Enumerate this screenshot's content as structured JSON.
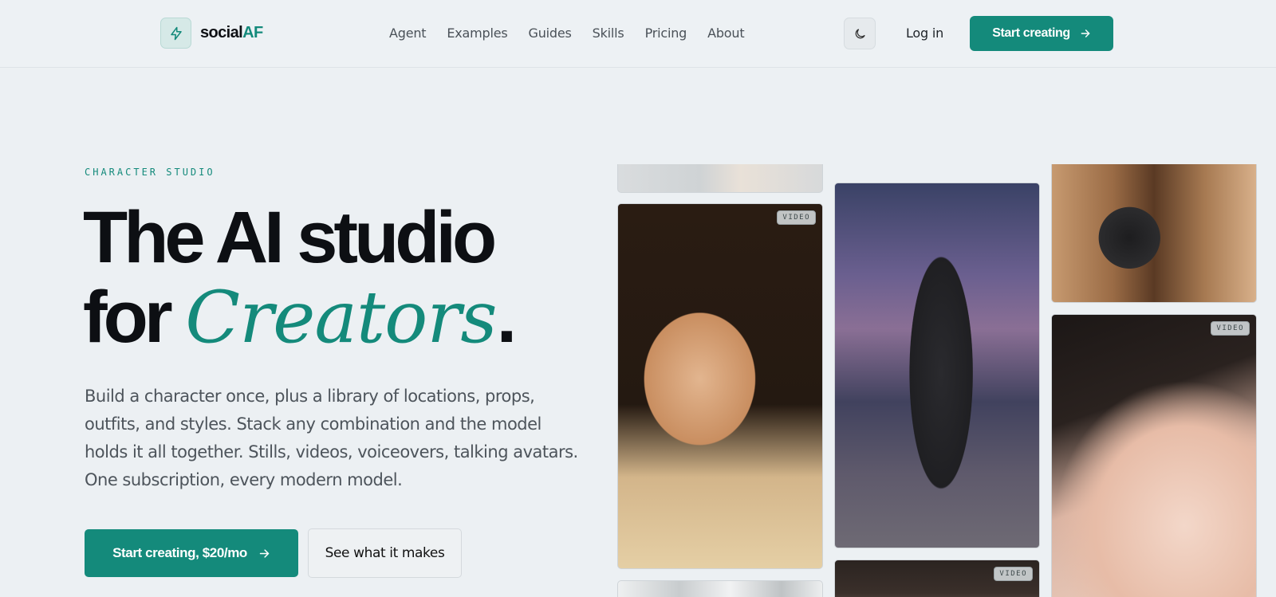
{
  "header": {
    "brand_main": "social",
    "brand_accent": "AF",
    "nav": [
      "Agent",
      "Examples",
      "Guides",
      "Skills",
      "Pricing",
      "About"
    ],
    "login": "Log in",
    "cta": "Start creating"
  },
  "hero": {
    "eyebrow": "CHARACTER STUDIO",
    "title_line1": "The AI studio",
    "title_line2_prefix": "for",
    "title_line2_script": "Creators",
    "title_line2_suffix": ".",
    "description": "Build a character once, plus a library of locations, props, outfits, and styles. Stack any combination and the model holds it all together. Stills, videos, voiceovers, talking avatars. One subscription, every modern model.",
    "primary_cta": "Start creating, $20/mo",
    "secondary_cta": "See what it makes"
  },
  "gallery": {
    "badge": "VIDEO"
  },
  "colors": {
    "accent": "#148a7b",
    "background": "#ecf0f3",
    "text": "#0d0f13"
  }
}
